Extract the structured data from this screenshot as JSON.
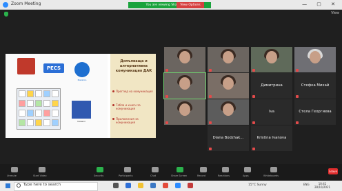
{
  "window": {
    "app_title": "Zoom Meeting",
    "controls": "— ▢ ✕"
  },
  "share_banner": {
    "text": "You are viewing Shared screen",
    "stop_label": "View Options",
    "view_label": "View"
  },
  "slide": {
    "title": "Допълваща и алтернативна комуникация ДАК",
    "bullets": [
      "Преглед на комуникация",
      "Табла и книги за комуникация",
      "Приложения за комуникация"
    ],
    "pecs_label": "PECS",
    "makaton_label": "Makaton",
    "card_label": "Символ"
  },
  "participants": [
    {
      "name": "",
      "video": true
    },
    {
      "name": "",
      "video": true
    },
    {
      "name": "",
      "video": true
    },
    {
      "name": "",
      "video": true
    },
    {
      "name": "",
      "video": true,
      "active": true
    },
    {
      "name": "",
      "video": true
    },
    {
      "name": "Димитрина",
      "video": false
    },
    {
      "name": "Стефка Михай",
      "video": false
    },
    {
      "name": "",
      "video": true
    },
    {
      "name": "",
      "video": true
    },
    {
      "name": "Iva",
      "video": false
    },
    {
      "name": "Стела Георгиева",
      "video": false
    },
    {
      "name": "Diana Bodzhak...",
      "video": false
    },
    {
      "name": "Kristina Ivanova",
      "video": false
    }
  ],
  "toolbar": {
    "buttons": [
      "Unmute",
      "Start Video",
      "Security",
      "Participants",
      "Chat",
      "Share Screen",
      "Record",
      "Reactions",
      "Apps",
      "Whiteboards"
    ],
    "leave_label": "Leave"
  },
  "taskbar": {
    "search_placeholder": "Type here to search",
    "weather": "15°C  Sunny",
    "lang": "ENG",
    "time": "10:41",
    "date": "28/10/2021"
  },
  "colors": {
    "accent": "#2d8cff",
    "share_green": "#1aa33c",
    "leave_red": "#e02e2e"
  }
}
